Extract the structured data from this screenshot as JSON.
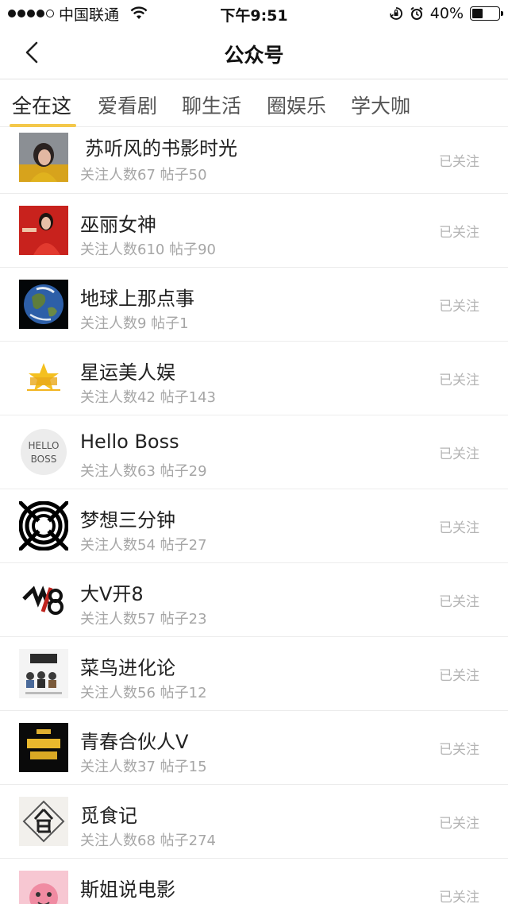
{
  "status_bar": {
    "carrier": "中国联通",
    "time": "下午9:51",
    "battery": "40%",
    "battery_level": 0.4,
    "icons": [
      "signal-icon",
      "wifi-icon",
      "orientation-lock-icon",
      "alarm-icon",
      "battery-icon"
    ]
  },
  "nav": {
    "title": "公众号",
    "back_icon": "chevron-left-icon"
  },
  "tabs": [
    {
      "label": "全在这",
      "active": true
    },
    {
      "label": "爱看剧",
      "active": false
    },
    {
      "label": "聊生活",
      "active": false
    },
    {
      "label": "圈娱乐",
      "active": false
    },
    {
      "label": "学大咖",
      "active": false
    }
  ],
  "accounts": [
    {
      "name": "苏听风的书影时光",
      "meta": "关注人数67 帖子50",
      "status": "已关注"
    },
    {
      "name": "巫丽女神",
      "meta": "关注人数610 帖子90",
      "status": "已关注"
    },
    {
      "name": "地球上那点事",
      "meta": "关注人数9 帖子1",
      "status": "已关注"
    },
    {
      "name": "星运美人娱",
      "meta": "关注人数42 帖子143",
      "status": "已关注"
    },
    {
      "name": "Hello Boss",
      "meta": "关注人数63 帖子29",
      "status": "已关注",
      "avatar_text": [
        "HELLO",
        "BOSS"
      ]
    },
    {
      "name": "梦想三分钟",
      "meta": "关注人数54 帖子27",
      "status": "已关注"
    },
    {
      "name": "大V开8",
      "meta": "关注人数57 帖子23",
      "status": "已关注"
    },
    {
      "name": "菜鸟进化论",
      "meta": "关注人数56 帖子12",
      "status": "已关注"
    },
    {
      "name": "青春合伙人V",
      "meta": "关注人数37 帖子15",
      "status": "已关注"
    },
    {
      "name": "觅食记",
      "meta": "关注人数68 帖子274",
      "status": "已关注"
    },
    {
      "name": "斯姐说电影",
      "meta": "",
      "status": "已关注"
    }
  ],
  "colors": {
    "accent": "#f4c84a",
    "follow_text": "#b4b4b4",
    "meta_text": "#a6a6a6"
  }
}
